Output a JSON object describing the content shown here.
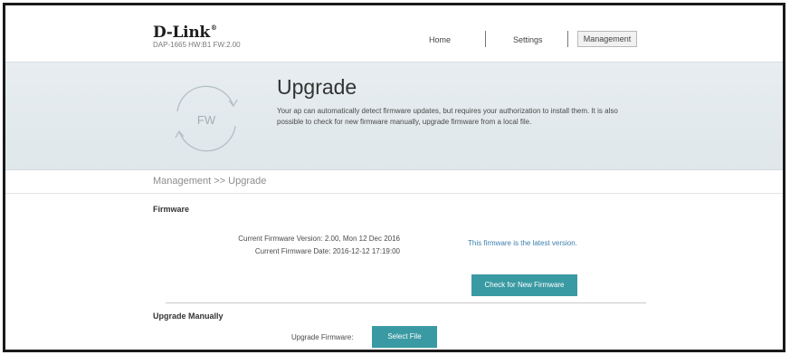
{
  "header": {
    "logo_text": "D-Link",
    "logo_mark": "®",
    "model_info": "DAP-1665 HW:B1 FW:2.00",
    "nav": {
      "home": "Home",
      "settings": "Settings",
      "management": "Management"
    }
  },
  "banner": {
    "icon_label": "FW",
    "icon_name": "firmware-refresh-icon",
    "title": "Upgrade",
    "description": "Your ap can automatically detect firmware updates, but requires your authorization to install them. It is also possible to check for new firmware manually, upgrade firmware from a local file."
  },
  "breadcrumb": "Management >> Upgrade",
  "firmware": {
    "title": "Firmware",
    "version_line": "Current Firmware Version: 2.00, Mon 12 Dec 2016",
    "date_line": "Current Firmware Date: 2016-12-12 17:19:00",
    "status": "This firmware is the latest version.",
    "check_button": "Check for New Firmware"
  },
  "upgrade_manually": {
    "title": "Upgrade Manually",
    "field_label": "Upgrade Firmware:",
    "select_button": "Select File"
  },
  "colors": {
    "accent_button": "#3a9aa3",
    "status_text": "#3d7fae",
    "banner_bg": "#e3eaed"
  }
}
